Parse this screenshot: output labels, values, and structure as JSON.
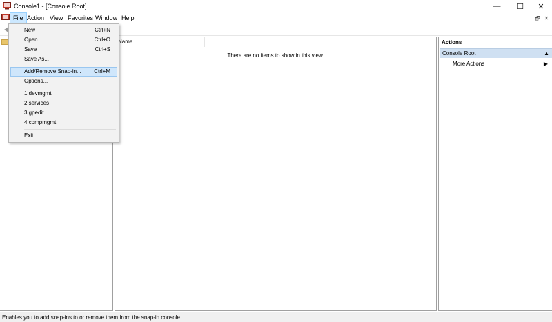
{
  "window": {
    "title": "Console1 - [Console Root]",
    "minimize_glyph": "—",
    "maximize_glyph": "☐",
    "close_glyph": "✕"
  },
  "menubar": {
    "items": [
      {
        "label": "File",
        "active": true
      },
      {
        "label": "Action"
      },
      {
        "label": "View"
      },
      {
        "label": "Favorites"
      },
      {
        "label": "Window"
      },
      {
        "label": "Help"
      }
    ],
    "mdi_minimize": "_",
    "mdi_restore": "🗗",
    "mdi_close": "✕"
  },
  "file_menu": {
    "items": [
      {
        "label": "New",
        "shortcut": "Ctrl+N"
      },
      {
        "label": "Open...",
        "shortcut": "Ctrl+O"
      },
      {
        "label": "Save",
        "shortcut": "Ctrl+S"
      },
      {
        "label": "Save As...",
        "shortcut": ""
      },
      {
        "label": "Add/Remove Snap-in...",
        "shortcut": "Ctrl+M",
        "highlighted": true
      },
      {
        "label": "Options...",
        "shortcut": ""
      },
      {
        "label": "1 devmgmt",
        "shortcut": ""
      },
      {
        "label": "2 services",
        "shortcut": ""
      },
      {
        "label": "3 gpedit",
        "shortcut": ""
      },
      {
        "label": "4 compmgmt",
        "shortcut": ""
      },
      {
        "label": "Exit",
        "shortcut": ""
      }
    ]
  },
  "main": {
    "column_name": "Name",
    "empty_message": "There are no items to show in this view."
  },
  "actions": {
    "title": "Actions",
    "section_label": "Console Root",
    "collapse_glyph": "▲",
    "more_actions": "More Actions",
    "more_arrow": "▶"
  },
  "status": {
    "text": "Enables you to add snap-ins to or remove them from the snap-in console."
  },
  "colors": {
    "menu_active_bg": "#cce8ff",
    "menu_highlight_bg": "#cfe6fb",
    "actions_section_bg": "#cfe0f2",
    "menu_bg": "#f2f2f2"
  }
}
